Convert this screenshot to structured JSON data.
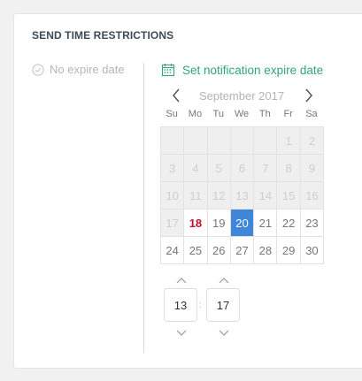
{
  "section": {
    "title": "SEND TIME RESTRICTIONS"
  },
  "options": {
    "no_expire_label": "No expire date",
    "set_expire_label": "Set notification expire date"
  },
  "calendar": {
    "month_label": "September 2017",
    "weekdays": [
      "Su",
      "Mo",
      "Tu",
      "We",
      "Th",
      "Fr",
      "Sa"
    ],
    "weeks": [
      [
        {
          "day": "",
          "state": "disabled"
        },
        {
          "day": "",
          "state": "disabled"
        },
        {
          "day": "",
          "state": "disabled"
        },
        {
          "day": "",
          "state": "disabled"
        },
        {
          "day": "",
          "state": "disabled"
        },
        {
          "day": "1",
          "state": "disabled"
        },
        {
          "day": "2",
          "state": "disabled"
        }
      ],
      [
        {
          "day": "3",
          "state": "disabled"
        },
        {
          "day": "4",
          "state": "disabled"
        },
        {
          "day": "5",
          "state": "disabled"
        },
        {
          "day": "6",
          "state": "disabled"
        },
        {
          "day": "7",
          "state": "disabled"
        },
        {
          "day": "8",
          "state": "disabled"
        },
        {
          "day": "9",
          "state": "disabled"
        }
      ],
      [
        {
          "day": "10",
          "state": "disabled"
        },
        {
          "day": "11",
          "state": "disabled"
        },
        {
          "day": "12",
          "state": "disabled"
        },
        {
          "day": "13",
          "state": "disabled"
        },
        {
          "day": "14",
          "state": "disabled"
        },
        {
          "day": "15",
          "state": "disabled"
        },
        {
          "day": "16",
          "state": "disabled"
        }
      ],
      [
        {
          "day": "17",
          "state": "disabled"
        },
        {
          "day": "18",
          "state": "today"
        },
        {
          "day": "19",
          "state": "normal"
        },
        {
          "day": "20",
          "state": "selected"
        },
        {
          "day": "21",
          "state": "normal"
        },
        {
          "day": "22",
          "state": "normal"
        },
        {
          "day": "23",
          "state": "normal"
        }
      ],
      [
        {
          "day": "24",
          "state": "normal"
        },
        {
          "day": "25",
          "state": "normal"
        },
        {
          "day": "26",
          "state": "normal"
        },
        {
          "day": "27",
          "state": "normal"
        },
        {
          "day": "28",
          "state": "normal"
        },
        {
          "day": "29",
          "state": "normal"
        },
        {
          "day": "30",
          "state": "normal"
        }
      ]
    ]
  },
  "time": {
    "hour": "13",
    "separator": ":",
    "minute": "17"
  },
  "icons": {
    "no_expire": "check-circle-icon",
    "set_expire": "calendar-icon",
    "prev": "chevron-left-icon",
    "next": "chevron-right-icon",
    "up": "chevron-up-icon",
    "down": "chevron-down-icon"
  },
  "colors": {
    "accent_green": "#34a283",
    "selected_blue": "#3f86da",
    "today_red": "#c8102e",
    "disabled_bg": "#efefef"
  }
}
